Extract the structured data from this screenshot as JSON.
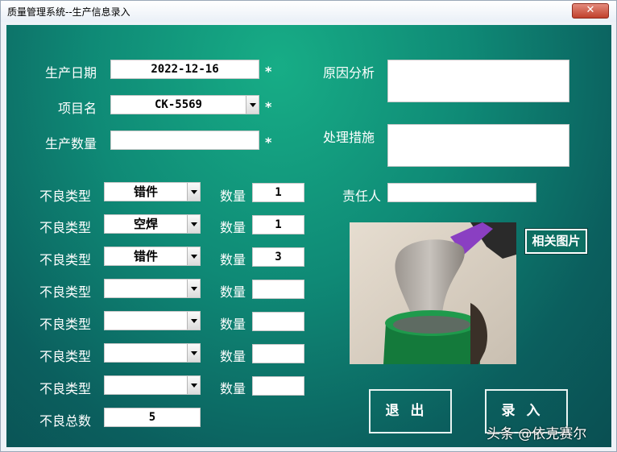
{
  "window": {
    "title": "质量管理系统--生产信息录入",
    "close_label": "✕"
  },
  "form": {
    "production_date_label": "生产日期",
    "production_date_value": "2022-12-16",
    "project_label": "项目名",
    "project_value": "CK-5569",
    "quantity_label": "生产数量",
    "quantity_value": "",
    "required_mark": "*",
    "cause_label": "原因分析",
    "cause_value": "",
    "measure_label": "处理措施",
    "measure_value": "",
    "responsible_label": "责任人",
    "responsible_value": "",
    "defects": [
      {
        "type_label": "不良类型",
        "type_value": "错件",
        "qty_label": "数量",
        "qty_value": "1"
      },
      {
        "type_label": "不良类型",
        "type_value": "空焊",
        "qty_label": "数量",
        "qty_value": "1"
      },
      {
        "type_label": "不良类型",
        "type_value": "错件",
        "qty_label": "数量",
        "qty_value": "3"
      },
      {
        "type_label": "不良类型",
        "type_value": "",
        "qty_label": "数量",
        "qty_value": ""
      },
      {
        "type_label": "不良类型",
        "type_value": "",
        "qty_label": "数量",
        "qty_value": ""
      },
      {
        "type_label": "不良类型",
        "type_value": "",
        "qty_label": "数量",
        "qty_value": ""
      },
      {
        "type_label": "不良类型",
        "type_value": "",
        "qty_label": "数量",
        "qty_value": ""
      }
    ],
    "total_label": "不良总数",
    "total_value": "5",
    "photo_button": "相关图片",
    "exit_button": "退出",
    "submit_button": "录入"
  },
  "watermark": "头条 @依克赛尔",
  "colors": {
    "form_background": "#0f8a76",
    "title_bar": "#eaf0f7",
    "close_button": "#c0412c"
  }
}
